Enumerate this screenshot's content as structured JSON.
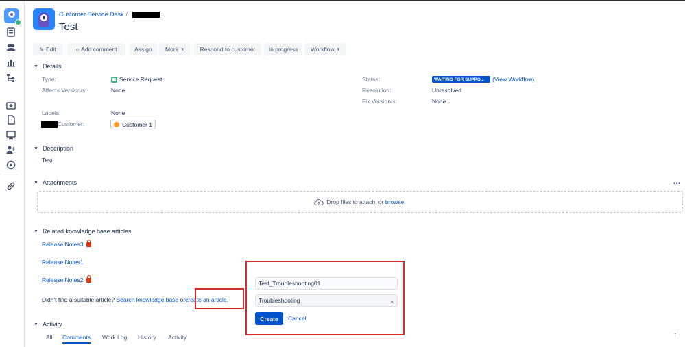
{
  "breadcrumb": {
    "project": "Customer Service Desk",
    "separator": "/"
  },
  "issue": {
    "title": "Test"
  },
  "toolbar": {
    "edit": "Edit",
    "add_comment": "Add comment",
    "assign": "Assign",
    "more": "More",
    "respond": "Respond to customer",
    "in_progress": "In progress",
    "workflow": "Workflow"
  },
  "details": {
    "heading": "Details",
    "type_label": "Type:",
    "type_value": "Service Request",
    "affects_label": "Affects Version/s:",
    "affects_value": "None",
    "labels_label": "Labels:",
    "labels_value": "None",
    "customer_label": "Customer:",
    "customer_value": "Customer 1",
    "status_label": "Status:",
    "status_value": "WAITING FOR SUPPO...",
    "view_workflow": "(View Workflow)",
    "resolution_label": "Resolution:",
    "resolution_value": "Unresolved",
    "fix_label": "Fix Version/s:",
    "fix_value": "None"
  },
  "description": {
    "heading": "Description",
    "text": "Test"
  },
  "attachments": {
    "heading": "Attachments",
    "drop_text": "Drop files to attach, or",
    "browse": "browse.",
    "more": "•••"
  },
  "kb": {
    "heading": "Related knowledge base articles",
    "articles": [
      {
        "title": "Release Notes3",
        "locked": true
      },
      {
        "title": "Release Notes1",
        "locked": false
      },
      {
        "title": "Release Notes2",
        "locked": true
      }
    ],
    "prompt": "Didn't find a suitable article?",
    "search_link": "Search knowledge base",
    "or": "or",
    "create_link": "create an article."
  },
  "popup": {
    "title_value": "Test_Troubleshooting01",
    "template_value": "Troubleshooting",
    "create": "Create",
    "cancel": "Cancel"
  },
  "activity": {
    "heading": "Activity",
    "tabs": [
      "All",
      "Comments",
      "Work Log",
      "History",
      "Activity"
    ],
    "active_tab": "Comments"
  },
  "colors": {
    "accent": "#0052cc",
    "highlight": "#d0312d",
    "status": "#0052cc",
    "type": "#36b37e"
  }
}
